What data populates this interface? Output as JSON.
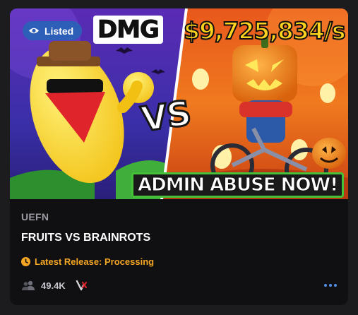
{
  "card": {
    "badge_label": "Listed",
    "thumbnail": {
      "left_text": "DMG",
      "right_text": "$9,725,834/s",
      "center_text": "VS",
      "banner_text": "ADMIN ABUSE NOW!"
    },
    "category": "UEFN",
    "title": "FRUITS VS BRAINROTS",
    "release_status": "Latest Release: Processing",
    "player_count": "49.4K"
  },
  "colors": {
    "accent_blue": "#2e5fb8",
    "status_orange": "#f5a623",
    "card_bg": "#101012"
  },
  "icons": [
    "eye-icon",
    "clock-icon",
    "players-icon",
    "verse-icon",
    "more-options-icon"
  ]
}
